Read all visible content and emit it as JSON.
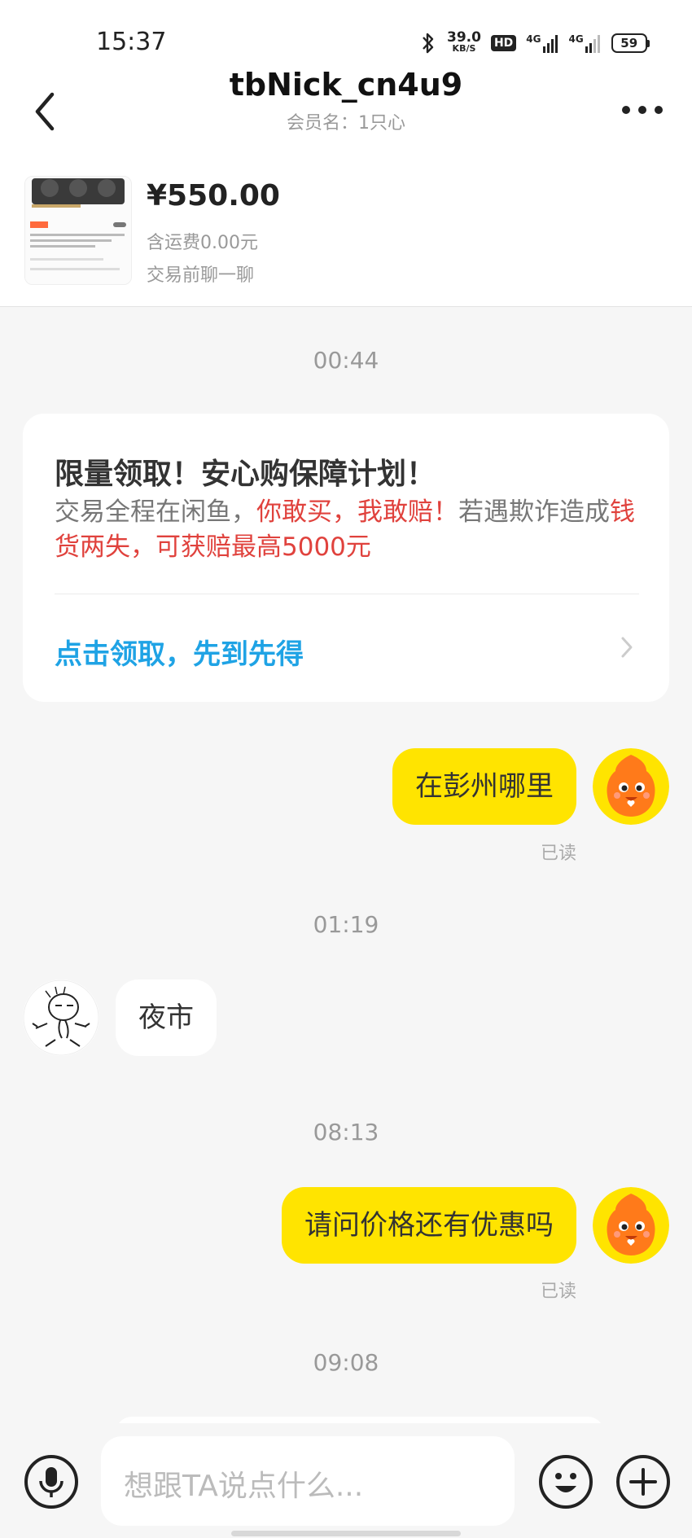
{
  "status_bar": {
    "time": "15:37",
    "net_speed_value": "39.0",
    "net_speed_unit": "KB/S",
    "hd_badge": "HD",
    "signal1_label": "4G",
    "signal2_label": "4G",
    "battery": "59"
  },
  "header": {
    "title": "tbNick_cn4u9",
    "subtitle": "会员名：1只心"
  },
  "product": {
    "price": "¥550.00",
    "shipping": "含运费0.00元",
    "note": "交易前聊一聊"
  },
  "messages": {
    "ts1": "00:44",
    "promo": {
      "title": "限量领取！安心购保障计划！",
      "body_1": "交易全程在闲鱼，",
      "body_2": "你敢买，我敢赔！",
      "body_3": "若遇欺诈造成",
      "body_4": "钱货两失，可获赔最高5000元",
      "link": "点击领取，先到先得"
    },
    "msg1": "在彭州哪里",
    "read1": "已读",
    "ts2": "01:19",
    "msg2": "夜市",
    "ts3": "08:13",
    "msg3": "请问价格还有优惠吗",
    "read2": "已读",
    "ts4": "09:08"
  },
  "input": {
    "placeholder": "想跟TA说点什么..."
  },
  "colors": {
    "accent_yellow": "#ffe400",
    "link_blue": "#1fa3e5",
    "warning_red": "#e0423d"
  }
}
